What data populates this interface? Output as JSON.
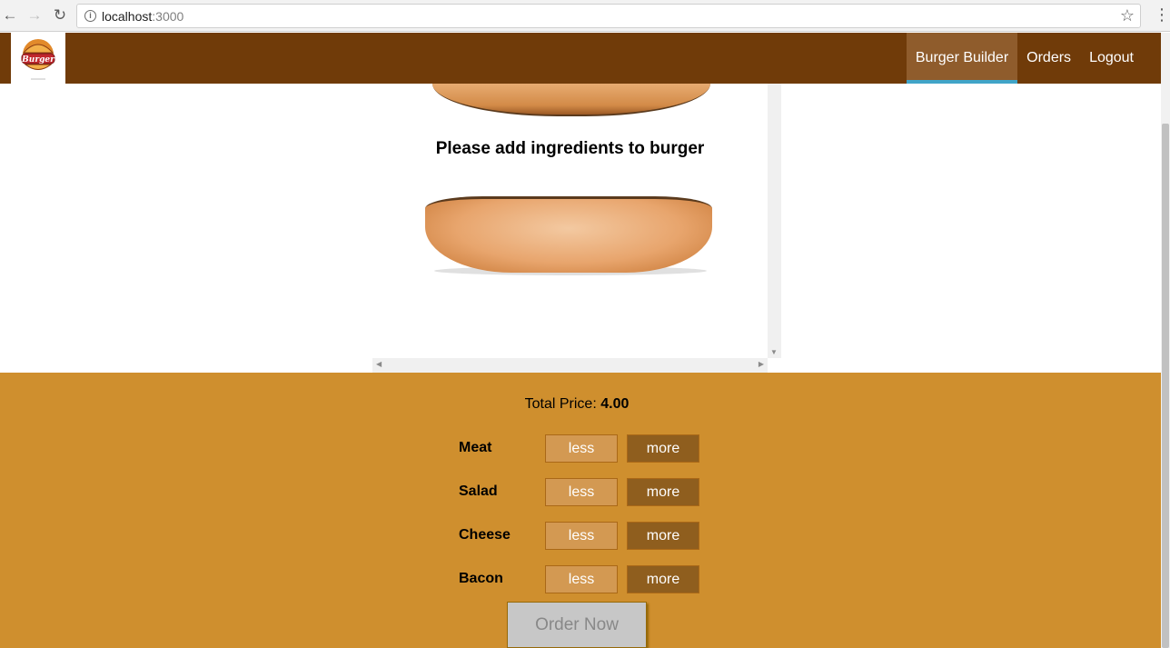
{
  "browser": {
    "back_icon": "←",
    "forward_icon": "→",
    "reload_icon": "↻",
    "url_host": "localhost",
    "url_port": ":3000",
    "info_icon": "i",
    "star_icon": "☆",
    "menu_icon": "⋮"
  },
  "toolbar": {
    "logo_text": "Burger",
    "nav": [
      {
        "label": "Burger Builder",
        "active": true
      },
      {
        "label": "Orders",
        "active": false
      },
      {
        "label": "Logout",
        "active": false
      }
    ]
  },
  "burger": {
    "message": "Please add ingredients to burger"
  },
  "controls": {
    "price_label": "Total Price:",
    "price_value": "4.00",
    "less_label": "less",
    "more_label": "more",
    "ingredients": [
      "Meat",
      "Salad",
      "Cheese",
      "Bacon"
    ],
    "order_button": "Order Now"
  },
  "colors": {
    "toolbar_bg": "#703b09",
    "active_tab_bg": "#8f5c2c",
    "active_tab_underline": "#40a4c8",
    "controls_bg": "#cf8f2e",
    "less_bg": "#d39952",
    "more_bg": "#8f5e1e",
    "order_disabled_bg": "#c7c7c7"
  }
}
